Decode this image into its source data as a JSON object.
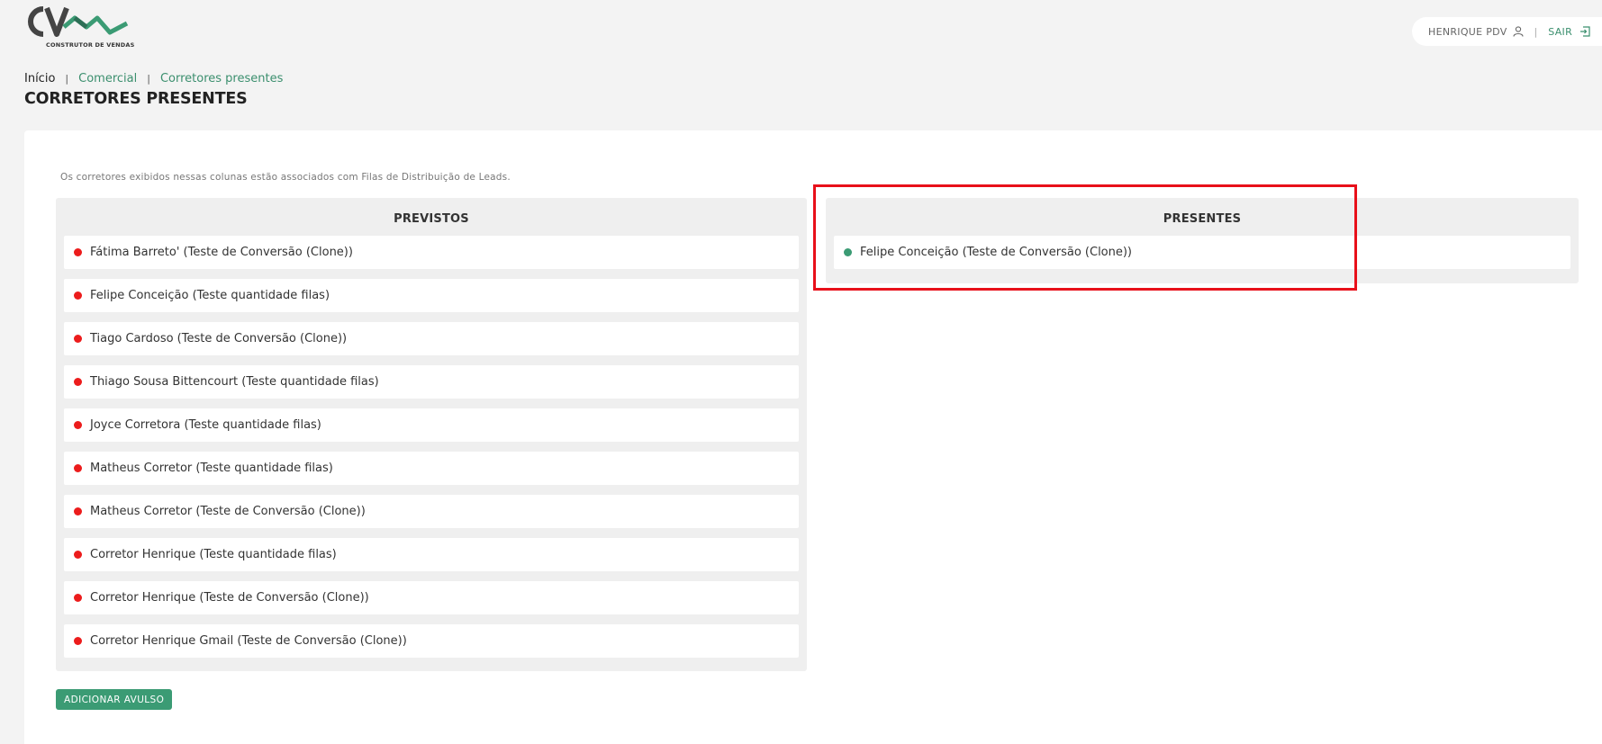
{
  "logo": {
    "text": "CV",
    "caption": "CONSTRUTOR DE VENDAS"
  },
  "user": {
    "name": "HENRIQUE PDV",
    "separator": "|",
    "logout": "SAIR"
  },
  "breadcrumb": {
    "home": "Início",
    "sep": "|",
    "items": [
      "Comercial",
      "Corretores presentes"
    ]
  },
  "page_title": "CORRETORES PRESENTES",
  "note": "Os corretores exibidos nessas colunas estão associados com Filas de Distribuição de Leads.",
  "previstos": {
    "title": "PREVISTOS",
    "items": [
      "Fátima Barreto' (Teste de Conversão (Clone))",
      "Felipe Conceição (Teste quantidade filas)",
      "Tiago Cardoso (Teste de Conversão (Clone))",
      "Thiago Sousa Bittencourt (Teste quantidade filas)",
      "Joyce Corretora (Teste quantidade filas)",
      "Matheus Corretor (Teste quantidade filas)",
      "Matheus Corretor (Teste de Conversão (Clone))",
      "Corretor Henrique (Teste quantidade filas)",
      "Corretor Henrique (Teste de Conversão (Clone))",
      "Corretor Henrique Gmail (Teste de Conversão (Clone))"
    ],
    "status_color": "#ec1c1c"
  },
  "presentes": {
    "title": "PRESENTES",
    "items": [
      "Felipe Conceição (Teste de Conversão (Clone))"
    ],
    "status_color": "#3b9b74"
  },
  "add_button": "ADICIONAR AVULSO",
  "colors": {
    "accent": "#3b9b74",
    "highlight": "#e8101a"
  }
}
